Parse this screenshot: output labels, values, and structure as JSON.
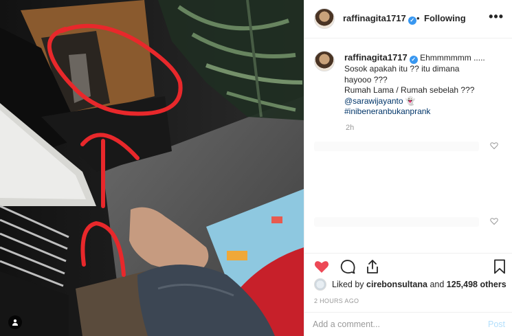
{
  "post": {
    "username": "raffinagita1717",
    "verified_icon": "verified-badge-icon",
    "separator": "•",
    "follow_status": "Following",
    "more_icon": "more-options-icon",
    "more_glyph": "•••"
  },
  "caption": {
    "username": "raffinagita1717",
    "lines": [
      "Ehmmmmmm .....",
      "Sosok apakah itu ?? itu dimana",
      "hayooo ???",
      "Rumah Lama / Rumah sebelah ???"
    ],
    "mention": "@sarawijayanto",
    "mention_emoji": "👻",
    "hashtag": "#inibeneranbukanprank",
    "time_ago": "2h"
  },
  "actions": {
    "like_icon": "heart-filled-icon",
    "comment_icon": "comment-icon",
    "share_icon": "share-icon",
    "save_icon": "bookmark-icon",
    "like_color": "#ed4956"
  },
  "likes": {
    "prefix": "Liked by",
    "first_user": "cirebonsultana",
    "connector": "and",
    "others": "125,498 others"
  },
  "timestamp": "2 HOURS AGO",
  "comment_box": {
    "placeholder": "Add a comment...",
    "post_label": "Post"
  },
  "colors": {
    "annotation_red": "#e8282b",
    "link_blue": "#003569",
    "verified_blue": "#3897f0"
  }
}
